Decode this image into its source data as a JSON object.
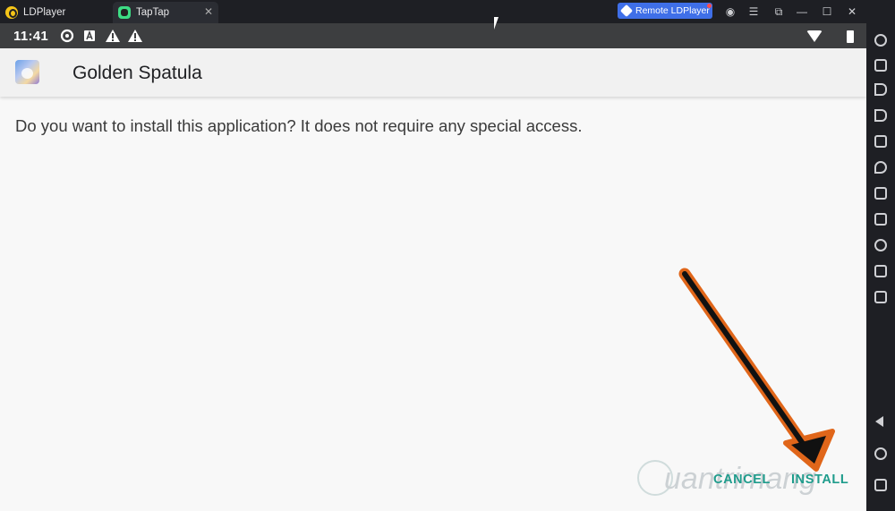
{
  "window": {
    "tabs": [
      {
        "label": "LDPlayer",
        "icon": "ldplayer-logo-icon"
      },
      {
        "label": "TapTap",
        "icon": "taptap-logo-icon",
        "active": true
      }
    ],
    "remote_button_label": "Remote LDPlayer",
    "controls": [
      "account-icon",
      "menu-icon",
      "resize-icon",
      "minimize-icon",
      "maximize-icon",
      "close-icon"
    ]
  },
  "status_bar": {
    "time": "11:41",
    "icons": [
      "sync-icon",
      "notification-a-icon",
      "warning-icon",
      "warning-icon",
      "wifi-icon",
      "battery-icon"
    ]
  },
  "app": {
    "name": "Golden Spatula",
    "icon": "golden-spatula-app-icon"
  },
  "dialog": {
    "message": "Do you want to install this application? It does not require any special access.",
    "cancel_label": "CANCEL",
    "install_label": "INSTALL",
    "accent_color": "#1f9c8c"
  },
  "annotation": {
    "arrow_color": "#e0661a"
  },
  "watermark": {
    "text": "uantrimang"
  },
  "sidebar": {
    "icons": [
      "settings-icon",
      "keyboard-icon",
      "volume-up-icon",
      "volume-down-icon",
      "screenshot-icon",
      "location-icon",
      "record-icon",
      "apk-icon",
      "scissors-icon",
      "video-icon",
      "more-icon"
    ],
    "nav": [
      "back-icon",
      "home-icon",
      "recent-apps-icon"
    ]
  }
}
